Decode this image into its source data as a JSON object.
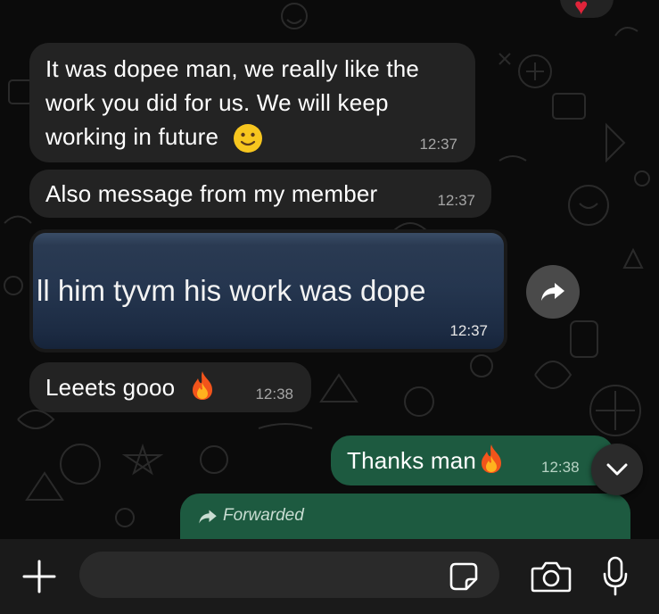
{
  "chat": {
    "messages": [
      {
        "direction": "incoming",
        "lines": [
          "It was dopee man, we really like the",
          "work you did for us. We will keep",
          "working in future"
        ],
        "emoji": "slightly-smiling-face",
        "time": "12:37"
      },
      {
        "direction": "incoming",
        "text": "Also message from my member",
        "time": "12:37"
      },
      {
        "direction": "incoming",
        "type": "image",
        "image_text": "ll him tyvm his work was dope",
        "time": "12:37"
      },
      {
        "direction": "incoming",
        "text": "Leeets gooo",
        "emoji": "fire",
        "time": "12:38"
      },
      {
        "direction": "outgoing",
        "text": "Thanks man",
        "emoji": "fire",
        "time": "12:38"
      },
      {
        "direction": "outgoing",
        "type": "forwarded",
        "label": "Forwarded"
      }
    ],
    "reaction": {
      "emoji": "red-heart"
    }
  },
  "composer": {
    "placeholder": "",
    "icons": [
      "plus-icon",
      "sticker-icon",
      "camera-icon",
      "microphone-icon"
    ]
  },
  "colors": {
    "incoming_bubble": "#232323",
    "outgoing_bubble": "#1d5a40",
    "background": "#0b0b0b",
    "bottom_bar": "#1a1a1a"
  }
}
